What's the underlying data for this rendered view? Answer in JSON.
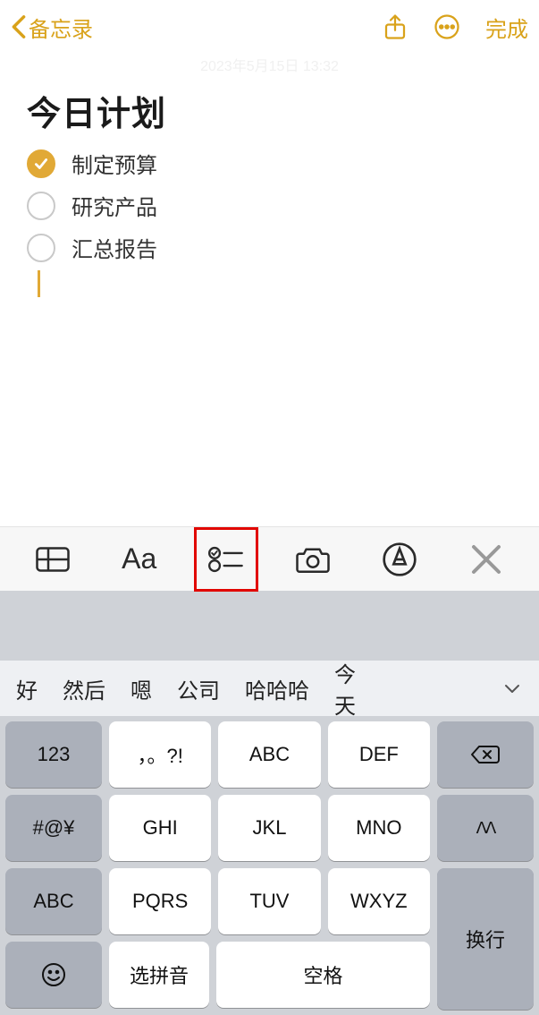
{
  "header": {
    "back_label": "备忘录",
    "done_label": "完成"
  },
  "timestamp": "2023年5月15日 13:32",
  "note": {
    "title": "今日计划",
    "items": [
      {
        "text": "制定预算",
        "checked": true
      },
      {
        "text": "研究产品",
        "checked": false
      },
      {
        "text": "汇总报告",
        "checked": false
      }
    ]
  },
  "toolbar": {
    "aa_label": "Aa"
  },
  "suggestions": [
    "好",
    "然后",
    "嗯",
    "公司",
    "哈哈哈",
    "今天"
  ],
  "keyboard": {
    "left_col": [
      "123",
      "#@¥",
      "ABC"
    ],
    "grid": [
      [
        "，。?!",
        "ABC",
        "DEF"
      ],
      [
        "GHI",
        "JKL",
        "MNO"
      ],
      [
        "PQRS",
        "TUV",
        "WXYZ"
      ]
    ],
    "emoji": "☺",
    "pinyin": "选拼音",
    "space": "空格",
    "right_caret": "ᐱᐱ",
    "return": "换行"
  }
}
